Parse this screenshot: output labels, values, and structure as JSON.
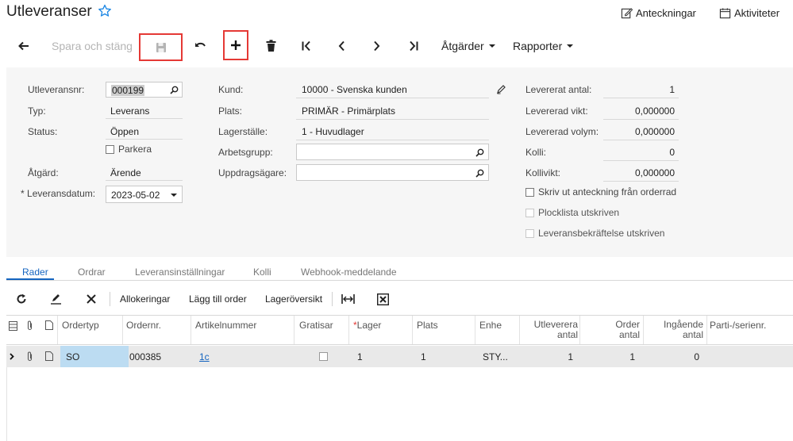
{
  "header": {
    "title": "Utleveranser",
    "notes_label": "Anteckningar",
    "activities_label": "Aktiviteter"
  },
  "toolbar": {
    "save_close_label": "Spara och stäng",
    "actions_label": "Åtgärder",
    "reports_label": "Rapporter"
  },
  "form": {
    "shipment_nbr_label": "Utleveransnr:",
    "shipment_nbr_value": "000199",
    "type_label": "Typ:",
    "type_value": "Leverans",
    "status_label": "Status:",
    "status_value": "Öppen",
    "hold_label": "Parkera",
    "operation_label": "Åtgärd:",
    "operation_value": "Ärende",
    "date_label": "Leveransdatum:",
    "date_value": "2023-05-02",
    "customer_label": "Kund:",
    "customer_value": "10000 - Svenska kunden",
    "location_label": "Plats:",
    "location_value": "PRIMÄR - Primärplats",
    "warehouse_label": "Lagerställe:",
    "warehouse_value": "1 - Huvudlager",
    "workgroup_label": "Arbetsgrupp:",
    "workgroup_value": "",
    "owner_label": "Uppdragsägare:",
    "owner_value": "",
    "shipped_qty_label": "Levererat antal:",
    "shipped_qty_value": "1",
    "shipped_weight_label": "Levererad vikt:",
    "shipped_weight_value": "0,000000",
    "shipped_volume_label": "Levererad volym:",
    "shipped_volume_value": "0,000000",
    "packages_label": "Kolli:",
    "packages_value": "0",
    "package_weight_label": "Kollivikt:",
    "package_weight_value": "0,000000",
    "print_note_label": "Skriv ut anteckning från orderrad",
    "picklist_label": "Plocklista utskriven",
    "confirmation_label": "Leveransbekräftelse utskriven"
  },
  "tabs": [
    "Rader",
    "Ordrar",
    "Leveransinställningar",
    "Kolli",
    "Webhook-meddelande"
  ],
  "grid_toolbar": {
    "allocations_label": "Allokeringar",
    "add_order_label": "Lägg till order",
    "inventory_label": "Lageröversikt"
  },
  "grid": {
    "columns": {
      "order_type": "Ordertyp",
      "order_nbr": "Ordernr.",
      "item": "Artikelnummer",
      "free": "Gratisar",
      "warehouse_req": "*",
      "warehouse": "Lager",
      "location": "Plats",
      "uom": "Enhe",
      "shipped_1": "Utleverera",
      "shipped_2": "antal",
      "ordered_1": "Order",
      "ordered_2": "antal",
      "open_1": "Ingående",
      "open_2": "antal",
      "lot": "Parti-/serienr."
    },
    "rows": [
      {
        "order_type": "SO",
        "order_nbr": "000385",
        "item": "1c",
        "warehouse": "1",
        "location": "1",
        "uom": "STY...",
        "shipped": "1",
        "ordered": "1",
        "open": "0"
      }
    ]
  },
  "colors": {
    "accent": "#1565c0",
    "highlight_border": "#e53935",
    "selected_cell": "#bcdcf2",
    "panel_bg": "#f6f6f6"
  }
}
